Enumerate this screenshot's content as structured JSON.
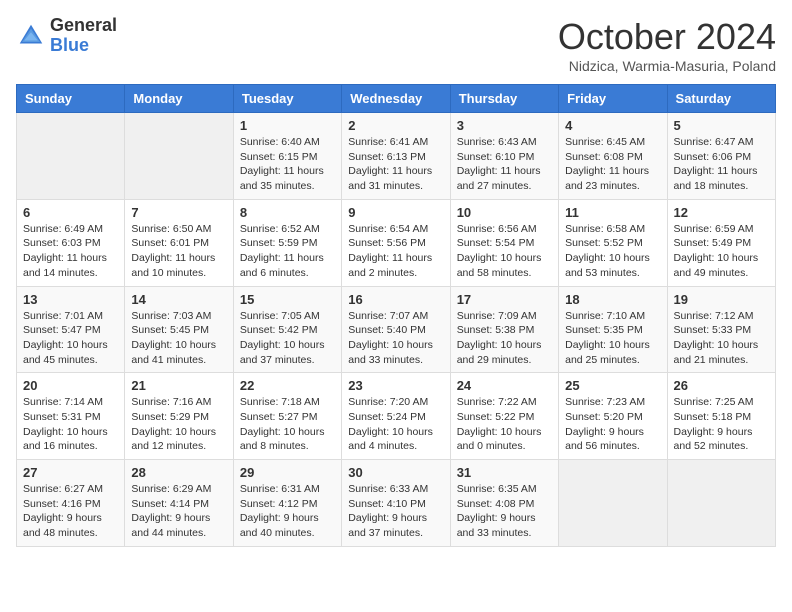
{
  "header": {
    "logo": {
      "general": "General",
      "blue": "Blue"
    },
    "title": "October 2024",
    "subtitle": "Nidzica, Warmia-Masuria, Poland"
  },
  "weekdays": [
    "Sunday",
    "Monday",
    "Tuesday",
    "Wednesday",
    "Thursday",
    "Friday",
    "Saturday"
  ],
  "weeks": [
    [
      {
        "day": "",
        "info": ""
      },
      {
        "day": "",
        "info": ""
      },
      {
        "day": "1",
        "info": "Sunrise: 6:40 AM\nSunset: 6:15 PM\nDaylight: 11 hours and 35 minutes."
      },
      {
        "day": "2",
        "info": "Sunrise: 6:41 AM\nSunset: 6:13 PM\nDaylight: 11 hours and 31 minutes."
      },
      {
        "day": "3",
        "info": "Sunrise: 6:43 AM\nSunset: 6:10 PM\nDaylight: 11 hours and 27 minutes."
      },
      {
        "day": "4",
        "info": "Sunrise: 6:45 AM\nSunset: 6:08 PM\nDaylight: 11 hours and 23 minutes."
      },
      {
        "day": "5",
        "info": "Sunrise: 6:47 AM\nSunset: 6:06 PM\nDaylight: 11 hours and 18 minutes."
      }
    ],
    [
      {
        "day": "6",
        "info": "Sunrise: 6:49 AM\nSunset: 6:03 PM\nDaylight: 11 hours and 14 minutes."
      },
      {
        "day": "7",
        "info": "Sunrise: 6:50 AM\nSunset: 6:01 PM\nDaylight: 11 hours and 10 minutes."
      },
      {
        "day": "8",
        "info": "Sunrise: 6:52 AM\nSunset: 5:59 PM\nDaylight: 11 hours and 6 minutes."
      },
      {
        "day": "9",
        "info": "Sunrise: 6:54 AM\nSunset: 5:56 PM\nDaylight: 11 hours and 2 minutes."
      },
      {
        "day": "10",
        "info": "Sunrise: 6:56 AM\nSunset: 5:54 PM\nDaylight: 10 hours and 58 minutes."
      },
      {
        "day": "11",
        "info": "Sunrise: 6:58 AM\nSunset: 5:52 PM\nDaylight: 10 hours and 53 minutes."
      },
      {
        "day": "12",
        "info": "Sunrise: 6:59 AM\nSunset: 5:49 PM\nDaylight: 10 hours and 49 minutes."
      }
    ],
    [
      {
        "day": "13",
        "info": "Sunrise: 7:01 AM\nSunset: 5:47 PM\nDaylight: 10 hours and 45 minutes."
      },
      {
        "day": "14",
        "info": "Sunrise: 7:03 AM\nSunset: 5:45 PM\nDaylight: 10 hours and 41 minutes."
      },
      {
        "day": "15",
        "info": "Sunrise: 7:05 AM\nSunset: 5:42 PM\nDaylight: 10 hours and 37 minutes."
      },
      {
        "day": "16",
        "info": "Sunrise: 7:07 AM\nSunset: 5:40 PM\nDaylight: 10 hours and 33 minutes."
      },
      {
        "day": "17",
        "info": "Sunrise: 7:09 AM\nSunset: 5:38 PM\nDaylight: 10 hours and 29 minutes."
      },
      {
        "day": "18",
        "info": "Sunrise: 7:10 AM\nSunset: 5:35 PM\nDaylight: 10 hours and 25 minutes."
      },
      {
        "day": "19",
        "info": "Sunrise: 7:12 AM\nSunset: 5:33 PM\nDaylight: 10 hours and 21 minutes."
      }
    ],
    [
      {
        "day": "20",
        "info": "Sunrise: 7:14 AM\nSunset: 5:31 PM\nDaylight: 10 hours and 16 minutes."
      },
      {
        "day": "21",
        "info": "Sunrise: 7:16 AM\nSunset: 5:29 PM\nDaylight: 10 hours and 12 minutes."
      },
      {
        "day": "22",
        "info": "Sunrise: 7:18 AM\nSunset: 5:27 PM\nDaylight: 10 hours and 8 minutes."
      },
      {
        "day": "23",
        "info": "Sunrise: 7:20 AM\nSunset: 5:24 PM\nDaylight: 10 hours and 4 minutes."
      },
      {
        "day": "24",
        "info": "Sunrise: 7:22 AM\nSunset: 5:22 PM\nDaylight: 10 hours and 0 minutes."
      },
      {
        "day": "25",
        "info": "Sunrise: 7:23 AM\nSunset: 5:20 PM\nDaylight: 9 hours and 56 minutes."
      },
      {
        "day": "26",
        "info": "Sunrise: 7:25 AM\nSunset: 5:18 PM\nDaylight: 9 hours and 52 minutes."
      }
    ],
    [
      {
        "day": "27",
        "info": "Sunrise: 6:27 AM\nSunset: 4:16 PM\nDaylight: 9 hours and 48 minutes."
      },
      {
        "day": "28",
        "info": "Sunrise: 6:29 AM\nSunset: 4:14 PM\nDaylight: 9 hours and 44 minutes."
      },
      {
        "day": "29",
        "info": "Sunrise: 6:31 AM\nSunset: 4:12 PM\nDaylight: 9 hours and 40 minutes."
      },
      {
        "day": "30",
        "info": "Sunrise: 6:33 AM\nSunset: 4:10 PM\nDaylight: 9 hours and 37 minutes."
      },
      {
        "day": "31",
        "info": "Sunrise: 6:35 AM\nSunset: 4:08 PM\nDaylight: 9 hours and 33 minutes."
      },
      {
        "day": "",
        "info": ""
      },
      {
        "day": "",
        "info": ""
      }
    ]
  ]
}
